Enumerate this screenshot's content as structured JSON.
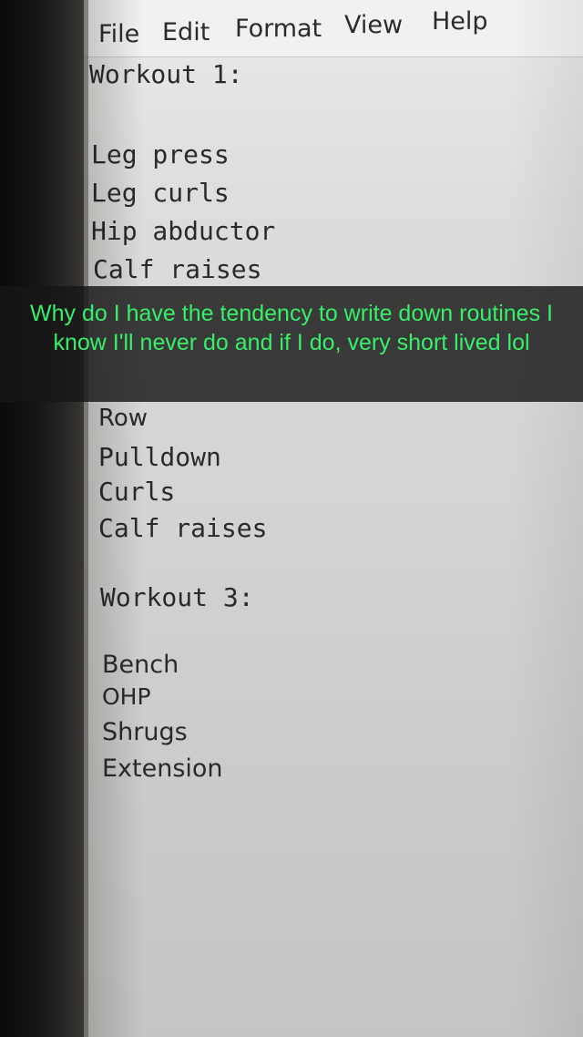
{
  "menu": {
    "file": "File",
    "edit": "Edit",
    "format": "Format",
    "view": "View",
    "help": "Help"
  },
  "document": {
    "lines": [
      "Workout 1:",
      "Leg press",
      "Leg curls",
      "Hip abductor",
      "Calf raises",
      "Row",
      "Pulldown",
      "Curls",
      "Calf raises",
      "Workout 3:",
      "Bench",
      "OHP",
      "Shrugs",
      "Extension"
    ]
  },
  "caption": {
    "text": "Why do I have the tendency to write down routines I know I'll never do and if I do, very short lived lol",
    "color": "#38ef6a"
  }
}
